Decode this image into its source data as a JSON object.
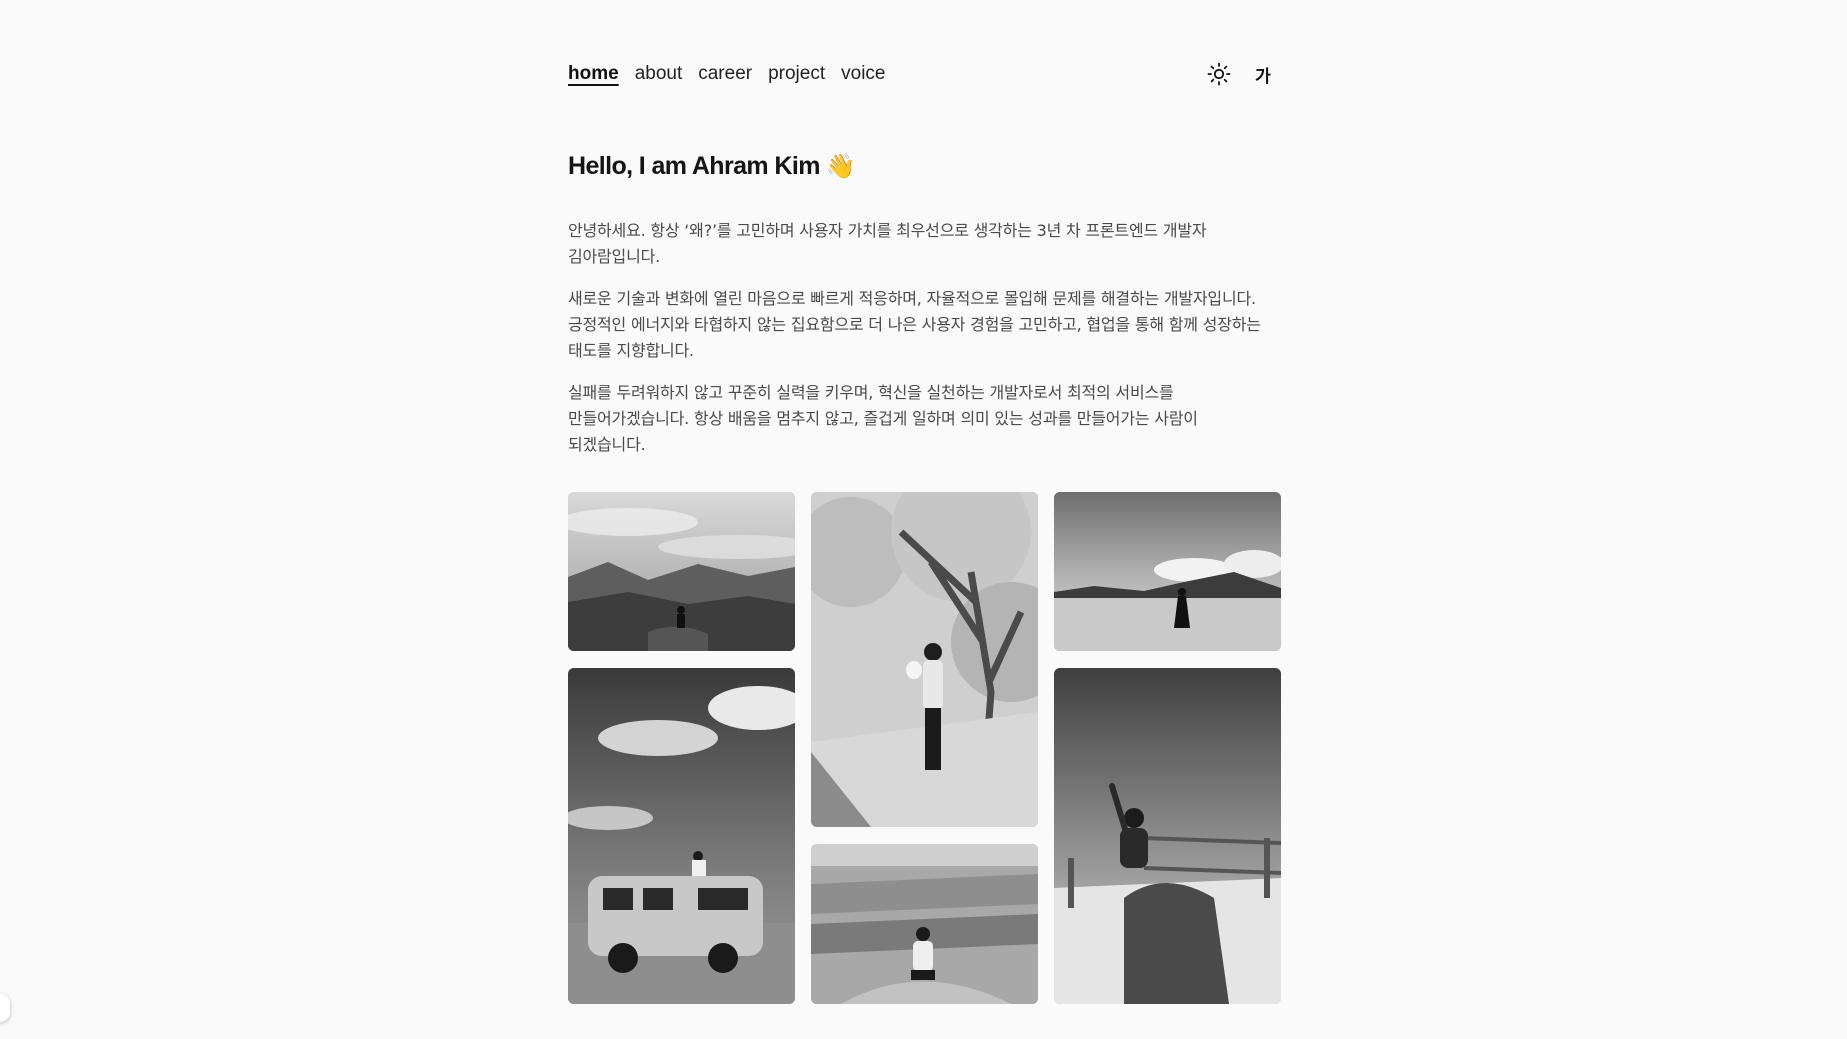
{
  "nav": {
    "links": [
      {
        "label": "home",
        "active": true
      },
      {
        "label": "about",
        "active": false
      },
      {
        "label": "career",
        "active": false
      },
      {
        "label": "project",
        "active": false
      },
      {
        "label": "voice",
        "active": false
      }
    ],
    "theme_icon": "sun-icon",
    "language_label": "가"
  },
  "hero": {
    "title": "Hello, I am Ahram Kim",
    "emoji": "👋"
  },
  "intro": {
    "paragraphs": [
      "안녕하세요. 항상 ‘왜?’를 고민하며 사용자 가치를 최우선으로 생각하는 3년 차 프론트엔드 개발자 김아람입니다.",
      "새로운 기술과 변화에 열린 마음으로 빠르게 적응하며, 자율적으로 몰입해 문제를 해결하는 개발자입니다. 긍정적인 에너지와 타협하지 않는 집요함으로 더 나은 사용자 경험을 고민하고, 협업을 통해 함께 성장하는 태도를 지향합니다.",
      "실패를 두려워하지 않고 꾸준히 실력을 키우며, 혁신을 실천하는 개발자로서 최적의 서비스를 만들어가겠습니다. 항상 배움을 멈추지 않고, 즐겁게 일하며 의미 있는 성과를 만들어가는 사람이 되겠습니다."
    ]
  },
  "gallery": {
    "photos": [
      {
        "name": "photo-mountain-valley"
      },
      {
        "name": "photo-cherry-blossom-tree"
      },
      {
        "name": "photo-beach-shore"
      },
      {
        "name": "photo-van-on-plain"
      },
      {
        "name": "photo-canyon-view"
      },
      {
        "name": "photo-summit-stone"
      }
    ]
  }
}
